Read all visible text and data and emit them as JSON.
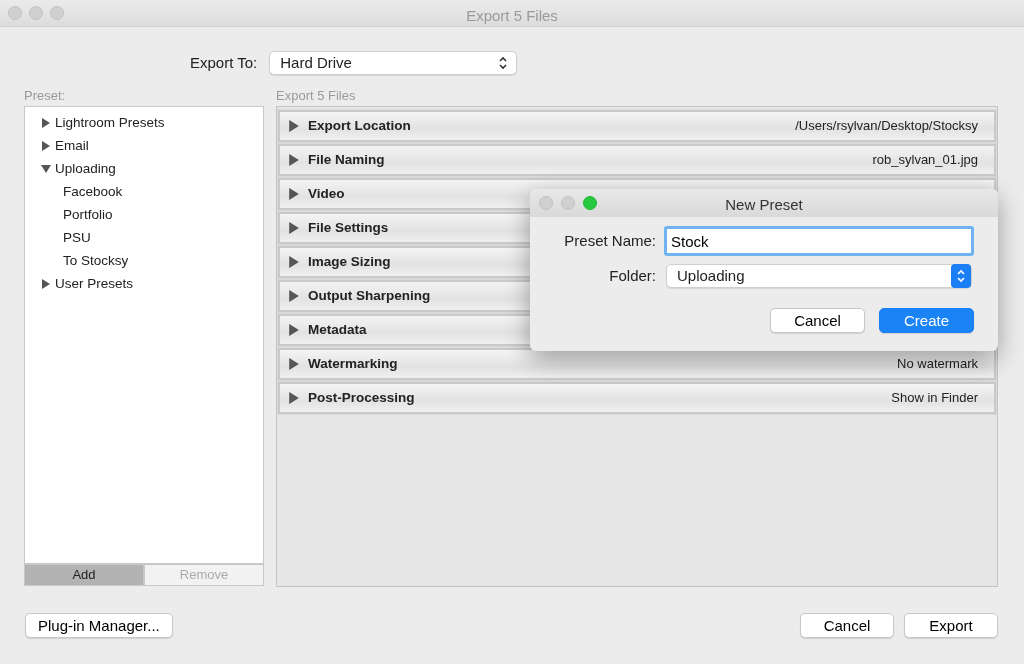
{
  "window": {
    "title": "Export 5 Files"
  },
  "export_to": {
    "label": "Export To:",
    "value": "Hard Drive"
  },
  "preset_label": "Preset:",
  "presets": [
    {
      "label": "Lightroom Presets",
      "expanded": false
    },
    {
      "label": "Email",
      "expanded": false
    },
    {
      "label": "Uploading",
      "expanded": true,
      "children": [
        {
          "label": "Facebook"
        },
        {
          "label": "Portfolio"
        },
        {
          "label": "PSU"
        },
        {
          "label": "To Stocksy"
        }
      ]
    },
    {
      "label": "User Presets",
      "expanded": false
    }
  ],
  "preset_buttons": [
    {
      "label": "Add",
      "disabled": false
    },
    {
      "label": "Remove",
      "disabled": true
    }
  ],
  "sections_title": "Export 5 Files",
  "sections": [
    {
      "label": "Export Location",
      "summary": "/Users/rsylvan/Desktop/Stocksy"
    },
    {
      "label": "File Naming",
      "summary": "rob_sylvan_01.jpg"
    },
    {
      "label": "Video"
    },
    {
      "label": "File Settings"
    },
    {
      "label": "Image Sizing"
    },
    {
      "label": "Output Sharpening"
    },
    {
      "label": "Metadata"
    },
    {
      "label": "Watermarking",
      "summary": "No watermark"
    },
    {
      "label": "Post-Processing",
      "summary": "Show in Finder"
    }
  ],
  "plugin_button": "Plug-in Manager...",
  "buttons": [
    "Cancel",
    "Export"
  ],
  "dialog": {
    "title": "New Preset",
    "name_label": "Preset Name:",
    "name_value": "Stock",
    "folder_label": "Folder:",
    "folder_value": "Uploading",
    "buttons": [
      {
        "label": "Cancel",
        "primary": false
      },
      {
        "label": "Create",
        "primary": true
      }
    ]
  }
}
